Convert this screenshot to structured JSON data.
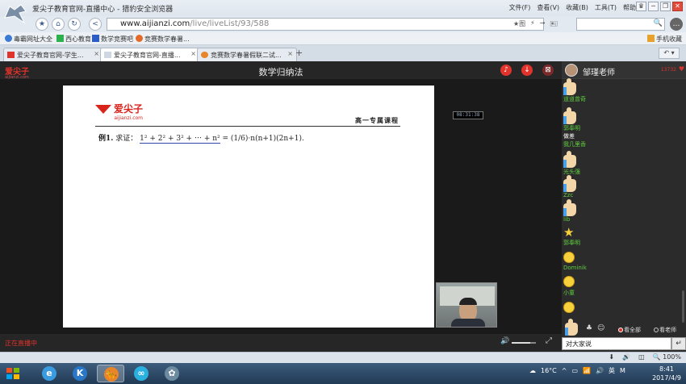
{
  "browser": {
    "window_title": "爱尖子教育官网-直播中心 - 猎豹安全浏览器",
    "menu": [
      "文件(F)",
      "查看(V)",
      "收藏(B)",
      "工具(T)",
      "帮助"
    ],
    "win_controls": [
      "♛",
      "─",
      "❐",
      "✕"
    ],
    "nav": {
      "favorite": "★",
      "home": "⌂",
      "refresh": "↻",
      "back": "<"
    },
    "url_host": "www.aijianzi.com",
    "url_path": "/live/liveList/93/588",
    "addr_right": [
      "★图",
      "⚡",
      "→",
      "🖭"
    ],
    "search_icon": "🔍",
    "comment_icon": "…",
    "bookmarks": [
      "毒霸网址大全",
      "西心教育",
      "数学竞赛吧",
      "竞赛数学春暑..."
    ],
    "mobile_fav": "手机收藏",
    "tabs": [
      {
        "label": "爱尖子教育官网-学生...",
        "active": false
      },
      {
        "label": "爱尖子教育官网-直播...",
        "active": true
      },
      {
        "label": "竞赛数学春暑假联二试...",
        "active": false
      }
    ],
    "new_tab": "+",
    "tab_nav": "↶ ▾",
    "close_glyph": "×"
  },
  "page": {
    "logo": "爱尖子",
    "logo_sub": "aijianzi.com",
    "title": "数学归纳法",
    "header_icons": [
      "♪",
      "↓",
      "⊠"
    ],
    "live_status": "正在直播中",
    "volume": 0.75,
    "vol_icon": "🔊",
    "fullscreen_icon": "⤢"
  },
  "slide": {
    "logo": "爱尖子",
    "logo_sub": "aijianzi.com",
    "course": "高一专属课程",
    "problem_label": "例1.",
    "problem_prefix": "求证：",
    "formula_lhs": "1² + 2² + 3² + ⋯ + n²",
    "formula_rhs": " = (1/6)·n(n+1)(2n+1)."
  },
  "video": {
    "timer": "08:31:38"
  },
  "chat": {
    "teacher_name": "邹瑾老师",
    "viewer_count": "13732",
    "like_icon": "♥",
    "messages": [
      {
        "type": "thumb",
        "user": "道道曾奇",
        "text": ""
      },
      {
        "type": "thumb",
        "user": "郭奉明",
        "text": "做差"
      },
      {
        "type": "none",
        "user": "",
        "text": "我几里香"
      },
      {
        "type": "thumb",
        "user": "光头强",
        "text": ""
      },
      {
        "type": "thumb",
        "user": "Zzc",
        "text": ""
      },
      {
        "type": "thumb",
        "user": "lib",
        "text": ""
      },
      {
        "type": "star",
        "user": "郭奉明",
        "text": ""
      },
      {
        "type": "smile",
        "user": "Dominik",
        "text": ""
      },
      {
        "type": "smile",
        "user": "小童",
        "text": ""
      },
      {
        "type": "smile",
        "user": "",
        "text": ""
      }
    ],
    "toolbar": {
      "flower": "♣",
      "emoji": "☺"
    },
    "filters": [
      {
        "label": "看全部",
        "selected": true
      },
      {
        "label": "看老师",
        "selected": false
      }
    ],
    "input_value": "对大家说",
    "send_glyph": "↵"
  },
  "status_bar": {
    "items": [
      "⬇",
      "🔊",
      "◫",
      "🔍 100%"
    ]
  },
  "taskbar": {
    "apps": [
      {
        "name": "ie",
        "glyph": "e",
        "color": "#3a9be0"
      },
      {
        "name": "kingsoft",
        "glyph": "K",
        "color": "#2a76c7"
      },
      {
        "name": "cheetah",
        "glyph": "🐆",
        "color": "#e8852a"
      },
      {
        "name": "app4",
        "glyph": "∞",
        "color": "#2ab0e0"
      },
      {
        "name": "app5",
        "glyph": "✿",
        "color": "#6c8aa0"
      }
    ],
    "tray": [
      "☁",
      "16°C",
      "^",
      "▭",
      "📶",
      "🔊",
      "英",
      "M"
    ],
    "clock_time": "8:41",
    "clock_date": "2017/4/9"
  }
}
